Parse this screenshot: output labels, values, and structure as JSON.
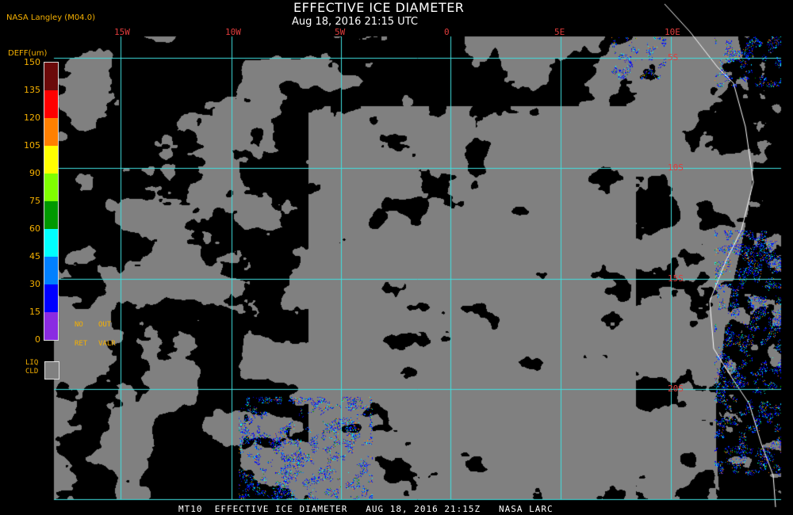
{
  "header": {
    "credit": "NASA Langley (M04.0)",
    "title": "EFFECTIVE ICE DIAMETER",
    "subtitle": "Aug 18, 2016 21:15 UTC"
  },
  "footer": {
    "caption": "MT10  EFFECTIVE ICE DIAMETER   AUG 18, 2016 21:15Z   NASA LARC"
  },
  "legend": {
    "unit": "DEFF(um)",
    "ticks": [
      "150",
      "135",
      "120",
      "105",
      "90",
      "75",
      "60",
      "45",
      "30",
      "15",
      "0"
    ],
    "colors": [
      "#6b0a0a",
      "#ff0000",
      "#ff8000",
      "#ffff00",
      "#80ff00",
      "#009900",
      "#00ffff",
      "#0080ff",
      "#0000ff",
      "#8a2be2"
    ],
    "no_ret": [
      "NO",
      "RET"
    ],
    "out_valr": [
      "OUT",
      "VALR"
    ],
    "liq_cld": [
      "LIQ",
      "CLD"
    ],
    "liq_color": "#808080"
  },
  "map": {
    "background": "#000000",
    "cloud_color": "#808080",
    "grid_color": "#40e0e0",
    "coast_color": "#ffffff",
    "lon_labels": [
      "15W",
      "10W",
      "5W",
      "0",
      "5E",
      "10E"
    ],
    "lat_labels": [
      "5S",
      "10S",
      "15S",
      "20S"
    ]
  }
}
